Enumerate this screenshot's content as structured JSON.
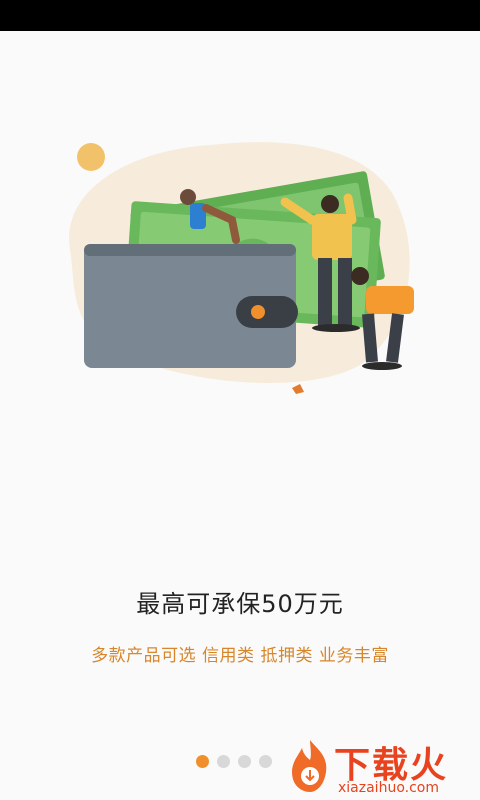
{
  "onboarding": {
    "headline": "最高可承保50万元",
    "subline": "多款产品可选 信用类 抵押类 业务丰富",
    "page_indicator": {
      "total": 4,
      "current": 1
    }
  },
  "watermark": {
    "title": "下载火",
    "url": "xiazaihuo.com"
  },
  "colors": {
    "accent": "#f0902c",
    "subline": "#d8862a",
    "watermark": "#e8421f"
  }
}
